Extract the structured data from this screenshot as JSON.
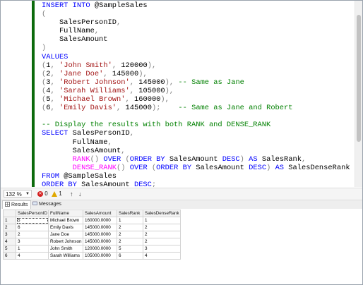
{
  "editor": {
    "code_lines": [
      [
        {
          "t": "INSERT INTO ",
          "c": "kw"
        },
        {
          "t": "@SampleSales",
          "c": ""
        }
      ],
      [
        {
          "t": "(",
          "c": "gray"
        }
      ],
      [
        {
          "t": "    SalesPersonID",
          "c": ""
        },
        {
          "t": ",",
          "c": "gray"
        }
      ],
      [
        {
          "t": "    FullName",
          "c": ""
        },
        {
          "t": ",",
          "c": "gray"
        }
      ],
      [
        {
          "t": "    SalesAmount",
          "c": ""
        }
      ],
      [
        {
          "t": ")",
          "c": "gray"
        }
      ],
      [
        {
          "t": "VALUES",
          "c": "kw"
        }
      ],
      [
        {
          "t": "(",
          "c": "gray"
        },
        {
          "t": "1",
          "c": ""
        },
        {
          "t": ", ",
          "c": "gray"
        },
        {
          "t": "'John Smith'",
          "c": "str"
        },
        {
          "t": ", ",
          "c": "gray"
        },
        {
          "t": "120000",
          "c": ""
        },
        {
          "t": "),",
          "c": "gray"
        }
      ],
      [
        {
          "t": "(",
          "c": "gray"
        },
        {
          "t": "2",
          "c": ""
        },
        {
          "t": ", ",
          "c": "gray"
        },
        {
          "t": "'Jane Doe'",
          "c": "str"
        },
        {
          "t": ", ",
          "c": "gray"
        },
        {
          "t": "145000",
          "c": ""
        },
        {
          "t": "),",
          "c": "gray"
        }
      ],
      [
        {
          "t": "(",
          "c": "gray"
        },
        {
          "t": "3",
          "c": ""
        },
        {
          "t": ", ",
          "c": "gray"
        },
        {
          "t": "'Robert Johnson'",
          "c": "str"
        },
        {
          "t": ", ",
          "c": "gray"
        },
        {
          "t": "145000",
          "c": ""
        },
        {
          "t": "),",
          "c": "gray"
        },
        {
          "t": " -- Same as Jane",
          "c": "cm"
        }
      ],
      [
        {
          "t": "(",
          "c": "gray"
        },
        {
          "t": "4",
          "c": ""
        },
        {
          "t": ", ",
          "c": "gray"
        },
        {
          "t": "'Sarah Williams'",
          "c": "str"
        },
        {
          "t": ", ",
          "c": "gray"
        },
        {
          "t": "105000",
          "c": ""
        },
        {
          "t": "),",
          "c": "gray"
        }
      ],
      [
        {
          "t": "(",
          "c": "gray"
        },
        {
          "t": "5",
          "c": ""
        },
        {
          "t": ", ",
          "c": "gray"
        },
        {
          "t": "'Michael Brown'",
          "c": "str"
        },
        {
          "t": ", ",
          "c": "gray"
        },
        {
          "t": "160000",
          "c": ""
        },
        {
          "t": "),",
          "c": "gray"
        }
      ],
      [
        {
          "t": "(",
          "c": "gray"
        },
        {
          "t": "6",
          "c": ""
        },
        {
          "t": ", ",
          "c": "gray"
        },
        {
          "t": "'Emily Davis'",
          "c": "str"
        },
        {
          "t": ", ",
          "c": "gray"
        },
        {
          "t": "145000",
          "c": ""
        },
        {
          "t": ");",
          "c": "gray"
        },
        {
          "t": "    -- Same as Jane and Robert",
          "c": "cm"
        }
      ],
      [],
      [
        {
          "t": "-- Display the results with both RANK and DENSE_RANK",
          "c": "cm"
        }
      ],
      [
        {
          "t": "SELECT ",
          "c": "kw"
        },
        {
          "t": "SalesPersonID",
          "c": ""
        },
        {
          "t": ",",
          "c": "gray"
        }
      ],
      [
        {
          "t": "       FullName",
          "c": ""
        },
        {
          "t": ",",
          "c": "gray"
        }
      ],
      [
        {
          "t": "       SalesAmount",
          "c": ""
        },
        {
          "t": ",",
          "c": "gray"
        }
      ],
      [
        {
          "t": "       ",
          "c": ""
        },
        {
          "t": "RANK",
          "c": "fn"
        },
        {
          "t": "() ",
          "c": "gray"
        },
        {
          "t": "OVER ",
          "c": "kw"
        },
        {
          "t": "(",
          "c": "gray"
        },
        {
          "t": "ORDER BY ",
          "c": "kw"
        },
        {
          "t": "SalesAmount ",
          "c": ""
        },
        {
          "t": "DESC",
          "c": "kw"
        },
        {
          "t": ") ",
          "c": "gray"
        },
        {
          "t": "AS ",
          "c": "kw"
        },
        {
          "t": "SalesRank",
          "c": ""
        },
        {
          "t": ",",
          "c": "gray"
        }
      ],
      [
        {
          "t": "       ",
          "c": ""
        },
        {
          "t": "DENSE_RANK",
          "c": "fn"
        },
        {
          "t": "() ",
          "c": "gray"
        },
        {
          "t": "OVER ",
          "c": "kw"
        },
        {
          "t": "(",
          "c": "gray"
        },
        {
          "t": "ORDER BY ",
          "c": "kw"
        },
        {
          "t": "SalesAmount ",
          "c": ""
        },
        {
          "t": "DESC",
          "c": "kw"
        },
        {
          "t": ") ",
          "c": "gray"
        },
        {
          "t": "AS ",
          "c": "kw"
        },
        {
          "t": "SalesDenseRank",
          "c": ""
        }
      ],
      [
        {
          "t": "FROM ",
          "c": "kw"
        },
        {
          "t": "@SampleSales",
          "c": ""
        }
      ],
      [
        {
          "t": "ORDER BY ",
          "c": "kw"
        },
        {
          "t": "SalesAmount ",
          "c": ""
        },
        {
          "t": "DESC",
          "c": "kw"
        },
        {
          "t": ";",
          "c": "gray"
        }
      ]
    ]
  },
  "status": {
    "zoom": "132 %",
    "errors": "0",
    "warnings": "1",
    "up_icon": "arrow-up-icon",
    "down_icon": "arrow-down-icon"
  },
  "tabs": {
    "results": "Results",
    "messages": "Messages"
  },
  "grid": {
    "columns": [
      "",
      "SalesPersonID",
      "FullName",
      "SalesAmount",
      "SalesRank",
      "SalesDenseRank"
    ],
    "rows": [
      [
        "1",
        "5",
        "Michael Brown",
        "160000.0000",
        "1",
        "1"
      ],
      [
        "2",
        "6",
        "Emily Davis",
        "145000.0000",
        "2",
        "2"
      ],
      [
        "3",
        "2",
        "Jane Doe",
        "145000.0000",
        "2",
        "2"
      ],
      [
        "4",
        "3",
        "Robert Johnson",
        "145000.0000",
        "2",
        "2"
      ],
      [
        "5",
        "1",
        "John Smith",
        "120000.0000",
        "5",
        "3"
      ],
      [
        "6",
        "4",
        "Sarah Williams",
        "105000.0000",
        "6",
        "4"
      ]
    ]
  },
  "colors": {
    "keyword": "#0000ff",
    "string": "#a31515",
    "function": "#ff00ff",
    "comment": "#008000",
    "change_bar": "#0b6a0b"
  }
}
